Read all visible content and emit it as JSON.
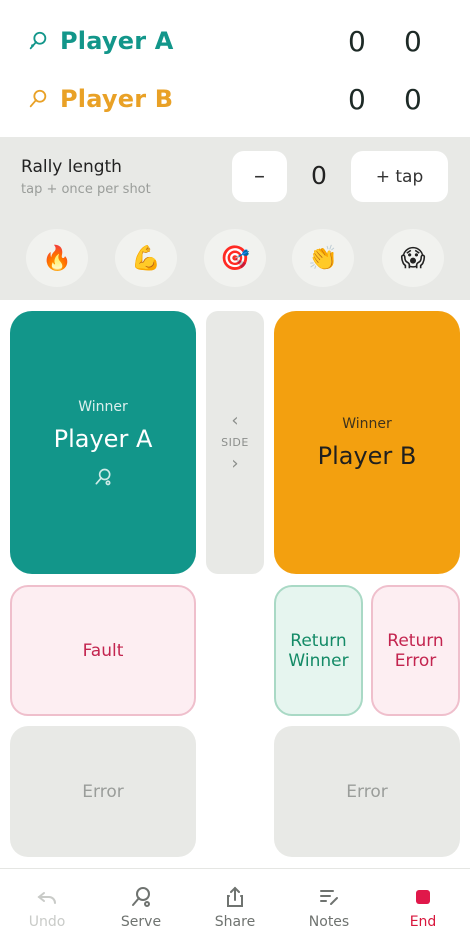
{
  "scoreboard": {
    "player_a": {
      "name": "Player A",
      "sets": "0",
      "games": "0",
      "color": "#12968a",
      "icon": "racket-icon"
    },
    "player_b": {
      "name": "Player B",
      "sets": "0",
      "games": "0",
      "color": "#e9a126",
      "icon": "racket-icon"
    }
  },
  "rally": {
    "title": "Rally length",
    "subtitle": "tap + once per shot",
    "minus_label": "–",
    "count": "0",
    "tap_label": "+ tap",
    "reactions": [
      "🔥",
      "💪",
      "🎯",
      "👏",
      "😱"
    ]
  },
  "winners": {
    "a": {
      "label": "Winner",
      "name": "Player A",
      "color": "#12968a"
    },
    "b": {
      "label": "Winner",
      "name": "Player B",
      "color": "#f3a00f"
    },
    "side_label": "SIDE"
  },
  "actions": {
    "fault": "Fault",
    "return_winner": "Return Winner",
    "return_error": "Return Error",
    "error_a": "Error",
    "error_b": "Error"
  },
  "nav": {
    "undo": "Undo",
    "serve": "Serve",
    "share": "Share",
    "notes": "Notes",
    "end": "End"
  }
}
